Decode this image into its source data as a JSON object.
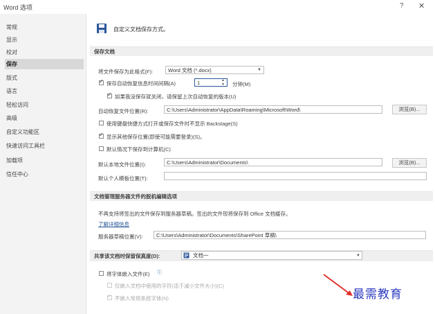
{
  "window": {
    "title": "Word 选项",
    "help": "?",
    "close": "✕"
  },
  "sidebar": {
    "items": [
      {
        "label": "常规"
      },
      {
        "label": "显示"
      },
      {
        "label": "校对"
      },
      {
        "label": "保存",
        "active": true
      },
      {
        "label": "版式"
      },
      {
        "label": "语言"
      },
      {
        "label": "轻松访问"
      },
      {
        "label": "高级"
      },
      {
        "label": "自定义功能区"
      },
      {
        "label": "快速访问工具栏"
      },
      {
        "label": "加载项"
      },
      {
        "label": "信任中心"
      }
    ]
  },
  "header": {
    "text": "自定义文档保存方式。",
    "icon": "save-icon",
    "icon_color": "#2b579a"
  },
  "save_docs": {
    "section_title": "保存文档",
    "format_label": "将文件保存为此格式(F):",
    "format_value": "Word 文档 (*.docx)",
    "autorecover_label": "保存自动恢复信息时间间隔(A)",
    "autorecover_checked": true,
    "autorecover_minutes": "1",
    "minutes_label": "分钟(M)",
    "keep_last_label": "如果我没保存就关闭，请保留上次自动恢复的版本(U)",
    "keep_last_checked": true,
    "autorecover_location_label": "自动恢复文件位置(R):",
    "autorecover_location_value": "C:\\Users\\Administrator\\AppData\\Roaming\\Microsoft\\Word\\",
    "browse_label": "浏览(B)...",
    "keyboard_label": "使用键盘快捷方式打开或保存文件时不显示 Backstage(S)",
    "keyboard_checked": false,
    "show_more_label": "显示其他保存位置(即使可能需要登录)(S)。",
    "show_more_checked": true,
    "default_local_label": "默认情况下保存到计算机(C)",
    "default_local_checked": false,
    "local_location_label": "默认本地文件位置(I):",
    "local_location_value": "C:\\Users\\Administrator\\Documents\\",
    "browse2_label": "浏览(B)...",
    "template_label": "默认个人模板位置(T):",
    "template_value": ""
  },
  "offline": {
    "section_title": "文档管理服务器文件的脱机编辑选项",
    "notice": "不再支持将签出的文件保存到服务器草稿。签出的文件现将保存到 Office 文档缓存。",
    "link": "了解详细信息",
    "drafts_label": "服务器草稿位置(V):",
    "drafts_value": "C:\\Users\\Administrator\\Documents\\SharePoint 草稿\\"
  },
  "fidelity": {
    "section_title": "共享该文档时保留保真度(D):",
    "doc_value": "文档一",
    "embed_fonts_label": "将字体嵌入文件(E)",
    "embed_fonts_checked": false,
    "embed_used_label": "仅嵌入文档中使用的字符(适于减小文件大小)(C)",
    "embed_used_checked": false,
    "no_common_label": "不嵌入常用系统字体(N)",
    "no_common_checked": true
  },
  "watermark": {
    "text": "最需教育",
    "color": "#2d3bbf"
  }
}
